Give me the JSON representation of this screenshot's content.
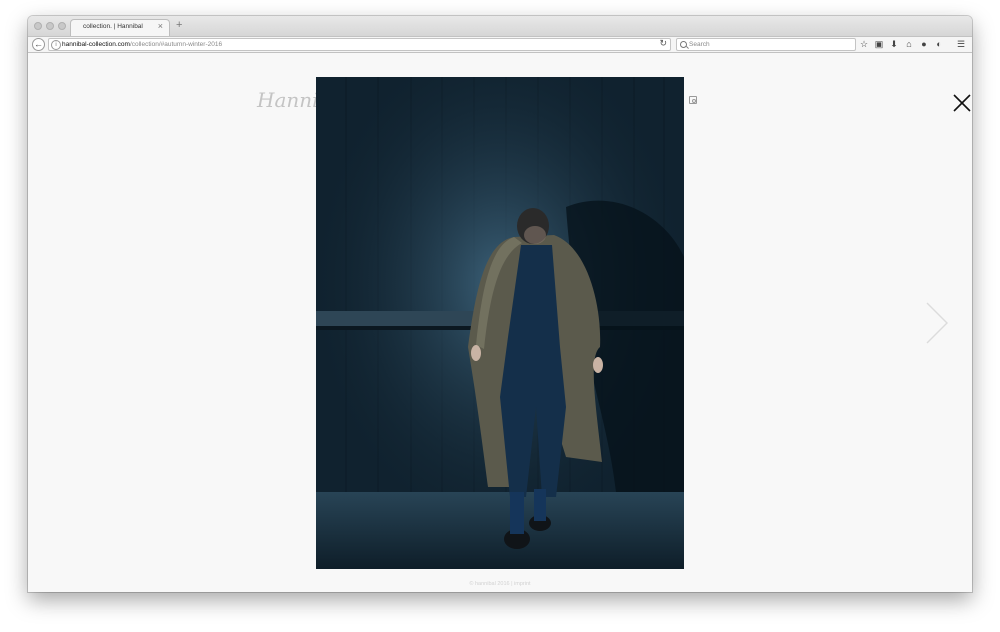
{
  "browser": {
    "tab_title": "collection. | Hannibal",
    "tab_close": "×",
    "new_tab": "+",
    "url_domain": "hannibal-collection.com",
    "url_path": "/collection/#autumn-winter-2016",
    "search_placeholder": "Search",
    "back_glyph": "←",
    "reload_glyph": "↻",
    "toolbar_icons": [
      "star-icon",
      "clipboard-icon",
      "download-icon",
      "home-icon",
      "chat-icon",
      "pocket-icon",
      "menu-icon"
    ]
  },
  "page": {
    "logo_text": "Hanni",
    "footer_text": "© hannibal 2016 | imprint",
    "accent_color": "#f8f8f8"
  },
  "lightbox": {
    "image_subject": "model in long tweed coat, dark blue outfit, against wooden wall"
  }
}
